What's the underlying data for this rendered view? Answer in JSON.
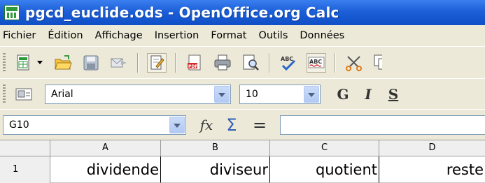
{
  "window": {
    "title": "pgcd_euclide.ods - OpenOffice.org Calc"
  },
  "menu": {
    "items": [
      "Fichier",
      "Édition",
      "Affichage",
      "Insertion",
      "Format",
      "Outils",
      "Données"
    ]
  },
  "toolbar": {
    "standard_icons": [
      "new-icon",
      "open-icon",
      "save-icon",
      "send-mail-icon",
      "edit-file-icon",
      "export-pdf-icon",
      "print-icon",
      "page-preview-icon",
      "spellcheck-icon",
      "autospellcheck-icon",
      "cut-icon",
      "copy-icon"
    ],
    "font_name": "Arial",
    "font_size": "10",
    "bold": "G",
    "italic": "I",
    "underline": "S"
  },
  "formula_bar": {
    "cell_reference": "G10",
    "function_wizard": "fx",
    "sum": "Σ",
    "function": "=",
    "input_value": ""
  },
  "sheet": {
    "columns": [
      "A",
      "B",
      "C",
      "D"
    ],
    "rows": [
      {
        "number": "1",
        "cells": [
          "dividende",
          "diviseur",
          "quotient",
          "reste"
        ]
      }
    ]
  },
  "colors": {
    "titlebar": "#1c5fd8",
    "toolbar_bg": "#ece9d8",
    "grid_header_bg": "#efefef"
  }
}
